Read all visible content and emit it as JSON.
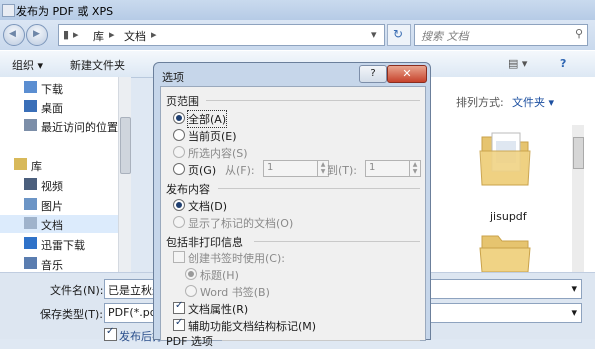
{
  "window": {
    "title": "发布为 PDF 或 XPS"
  },
  "nav": {
    "back_glyph": "◀",
    "forward_glyph": "▶",
    "breadcrumb": [
      "库",
      "文档"
    ],
    "search_placeholder": "搜索 文档"
  },
  "toolbar": {
    "organize": "组织 ▾",
    "new_folder": "新建文件夹"
  },
  "sidebar": {
    "items": [
      {
        "label": "下载",
        "icon": "download-folder-icon"
      },
      {
        "label": "桌面",
        "icon": "desktop-icon"
      },
      {
        "label": "最近访问的位置",
        "icon": "recent-places-icon"
      },
      {
        "label": "库",
        "icon": "library-icon"
      },
      {
        "label": "视频",
        "icon": "video-library-icon"
      },
      {
        "label": "图片",
        "icon": "picture-library-icon"
      },
      {
        "label": "文档",
        "icon": "document-library-icon"
      },
      {
        "label": "迅雷下载",
        "icon": "thunder-download-icon"
      },
      {
        "label": "音乐",
        "icon": "music-library-icon"
      }
    ]
  },
  "filepane": {
    "sort_label": "排列方式:",
    "sort_value": "文件夹 ▾",
    "folder_name": "jisupdf"
  },
  "bottom": {
    "filename_label": "文件名(N):",
    "filename_value": "已是立秋过",
    "savetype_label": "保存类型(T):",
    "savetype_value": "PDF(*.pdf)",
    "publish_after": "发布后打"
  },
  "dialog": {
    "title": "选项",
    "help_glyph": "?",
    "close_glyph": "✕",
    "page_range": {
      "heading": "页范围",
      "all": "全部(A)",
      "current": "当前页(E)",
      "selection": "所选内容(S)",
      "pages": "页(G)",
      "from_label": "从(F):",
      "from_value": "1",
      "to_label": "到(T):",
      "to_value": "1",
      "selected": "all"
    },
    "publish_what": {
      "heading": "发布内容",
      "document": "文档(D)",
      "doc_markup": "显示了标记的文档(O)",
      "selected": "document"
    },
    "nonprint": {
      "heading": "包括非打印信息",
      "create_bookmarks": "创建书签时使用(C):",
      "headings": "标题(H)",
      "word_bookmarks": "Word 书签(B)",
      "doc_properties": "文档属性(R)",
      "doc_properties_checked": true,
      "accessibility_tags": "辅助功能文档结构标记(M)",
      "accessibility_tags_checked": true
    },
    "pdf_options": {
      "heading": "PDF 选项"
    }
  }
}
